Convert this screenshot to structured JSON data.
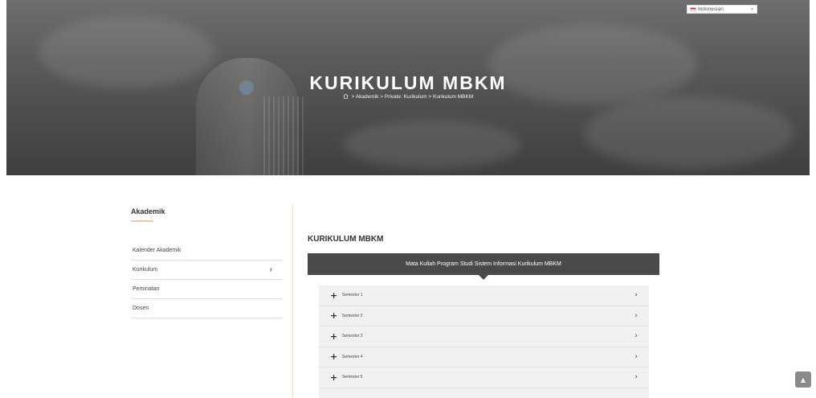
{
  "language": {
    "selected": "Indonesian",
    "flag_icon": "indonesia-flag-icon"
  },
  "hero": {
    "title": "KURIKULUM MBKM",
    "breadcrumb": [
      "Akademik",
      "Private: Kurikulum",
      "Kurikulum MBKM"
    ],
    "separator": ">"
  },
  "sidebar": {
    "title": "Akademik",
    "items": [
      {
        "label": "Kalender Akademik",
        "has_arrow": false
      },
      {
        "label": "Kurikulum",
        "has_arrow": true
      },
      {
        "label": "Peminatan",
        "has_arrow": false
      },
      {
        "label": "Dosen",
        "has_arrow": false
      }
    ],
    "arrow_glyph": "›"
  },
  "main": {
    "title": "KURIKULUM MBKM",
    "banner": "Mata Kuliah Program Studi Sistem Informasi Kurikulum MBKM",
    "accordion": [
      {
        "label": "Semester 1"
      },
      {
        "label": "Semester 2"
      },
      {
        "label": "Semester 3"
      },
      {
        "label": "Semester 4"
      },
      {
        "label": "Semester 5"
      }
    ]
  },
  "colors": {
    "accent": "#f3c5a8",
    "banner": "#4a4a4a",
    "accordion_bg": "#f1f1f1"
  }
}
